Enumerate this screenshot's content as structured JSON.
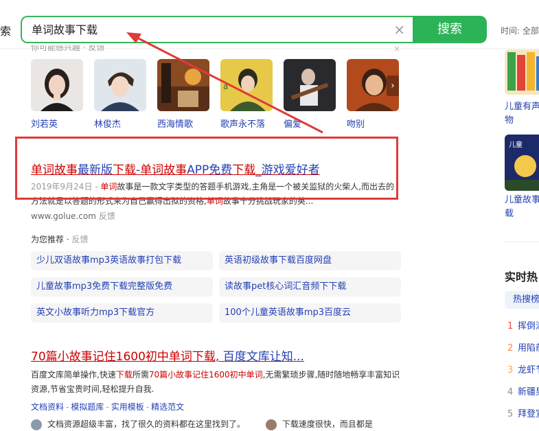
{
  "search": {
    "label_cut": "索",
    "query": "单词故事下载",
    "clear_glyph": "×",
    "button": "搜索",
    "time_filter": "时间: 全部"
  },
  "interest": {
    "head": "你可能感兴趣 · 反馈",
    "close": "×",
    "next": "›",
    "people": [
      {
        "name": "刘若英"
      },
      {
        "name": "林俊杰"
      },
      {
        "name": "西海情歌"
      },
      {
        "name": "歌声永不落"
      },
      {
        "name": "偏爱"
      },
      {
        "name": "吻别"
      }
    ]
  },
  "result1": {
    "title_a": "单词故事",
    "title_b": "最新版",
    "title_c": "下载",
    "title_d": "-",
    "title_e": "单词故事",
    "title_f": "APP免费",
    "title_g": "下载",
    "title_h": "_游戏爱好者",
    "date": "2019年9月24日 - ",
    "kw1": "单词",
    "text1": "故事是一款文字类型的答题手机游戏,主角是一个被关监狱的火柴人,而出去的方法就是以答题的形式来为自己赢得出狱的资格,",
    "kw2": "单词",
    "text2": "故事十分挑战玩家的英...",
    "source": "www.golue.com",
    "feedback": "反馈"
  },
  "recommend": {
    "head": "为您推荐",
    "feedback": "反馈",
    "items": [
      "少儿双语故事mp3英语故事打包下载",
      "英语初级故事下载百度网盘",
      "儿童故事mp3免费下载完整版免费",
      "读故事pet核心词汇音频下下载",
      "英文小故事听力mp3下载官方",
      "100个儿童英语故事mp3百度云"
    ]
  },
  "result2": {
    "title_a": "70篇小故事记住1600初中",
    "title_b": "单词下载",
    "title_c": ", 百度文库让知...",
    "text_a": "百度文库简单操作,快速",
    "kw1": "下载",
    "text_b": "所需",
    "kw2": "70篇小故事记住1600初中单词",
    "text_c": ",无需繁琐步骤,随时随地畅享丰富知识资源,节省宝贵时间,轻松提升自我.",
    "links": [
      "文档资料",
      "模拟题库",
      "实用模板",
      "精选范文"
    ],
    "link_sep": "-",
    "comment1": "文档资源超级丰富，找了很久的资料都在这里找到了。",
    "comment2": "下载速度很快，而且都是"
  },
  "right": {
    "book1_line1": "儿童有声",
    "book1_line2": "物",
    "book2_line1": "儿童故事",
    "book2_line2": "载",
    "hot_title": "实时热",
    "hot_tab": "热搜榜",
    "hot_items": [
      {
        "rank": "1",
        "text": "挥倒浪",
        "color": "#f54545"
      },
      {
        "rank": "2",
        "text": "用陷前",
        "color": "#ff8547"
      },
      {
        "rank": "3",
        "text": "龙虾节",
        "color": "#ffac38"
      },
      {
        "rank": "4",
        "text": "新疆男",
        "color": "#8e8e8e"
      },
      {
        "rank": "5",
        "text": "拜登宣",
        "color": "#8e8e8e"
      }
    ]
  },
  "colors": {
    "brand_green": "#2db357",
    "link_blue": "#2440b3",
    "keyword_red": "#c00",
    "annotation_red": "#e03a3a"
  }
}
